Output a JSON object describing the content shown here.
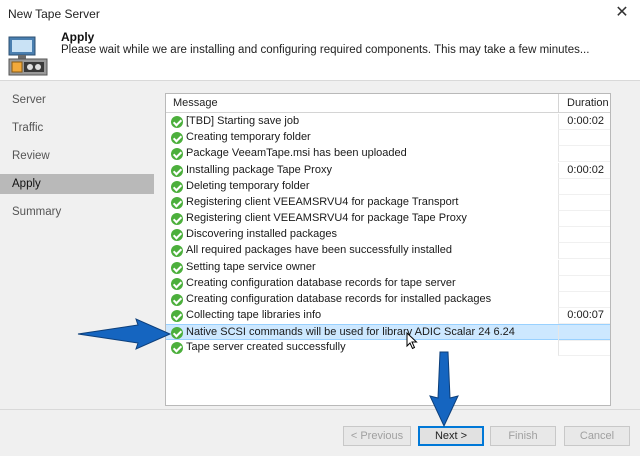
{
  "window": {
    "title": "New Tape Server",
    "close_icon": "close-icon"
  },
  "header": {
    "title": "Apply",
    "subtitle": "Please wait while we are installing and configuring required components. This may take a few minutes...",
    "icon": "tape-server-icon"
  },
  "sidebar": {
    "items": [
      {
        "label": "Server"
      },
      {
        "label": "Traffic"
      },
      {
        "label": "Review"
      },
      {
        "label": "Apply"
      },
      {
        "label": "Summary"
      }
    ],
    "active": "Apply"
  },
  "log": {
    "columns": {
      "message": "Message",
      "duration": "Duration"
    },
    "rows": [
      {
        "message": "[TBD] Starting save job",
        "duration": "0:00:02"
      },
      {
        "message": "Creating temporary folder",
        "duration": ""
      },
      {
        "message": "Package VeeamTape.msi has been uploaded",
        "duration": ""
      },
      {
        "message": "Installing package Tape Proxy",
        "duration": "0:00:02"
      },
      {
        "message": "Deleting temporary folder",
        "duration": ""
      },
      {
        "message": "Registering client VEEAMSRVU4 for package Transport",
        "duration": ""
      },
      {
        "message": "Registering client VEEAMSRVU4 for package Tape Proxy",
        "duration": ""
      },
      {
        "message": "Discovering installed packages",
        "duration": ""
      },
      {
        "message": "All required packages have been successfully installed",
        "duration": ""
      },
      {
        "message": "Setting tape service owner",
        "duration": ""
      },
      {
        "message": "Creating configuration database records for tape server",
        "duration": ""
      },
      {
        "message": "Creating configuration database records for installed packages",
        "duration": ""
      },
      {
        "message": "Collecting tape libraries info",
        "duration": "0:00:07"
      },
      {
        "message": "Native SCSI commands will be used for library ADIC Scalar 24 6.24",
        "duration": ""
      },
      {
        "message": "Tape server created successfully",
        "duration": ""
      }
    ],
    "selected_row": 14,
    "status_icon": "success-check-icon"
  },
  "buttons": {
    "previous": "< Previous",
    "next": "Next >",
    "finish": "Finish",
    "cancel": "Cancel"
  },
  "colors": {
    "accent": "#0078d7",
    "success": "#4caf3c",
    "annotation_arrow": "#1565c0",
    "selection": "#cde8ff"
  }
}
